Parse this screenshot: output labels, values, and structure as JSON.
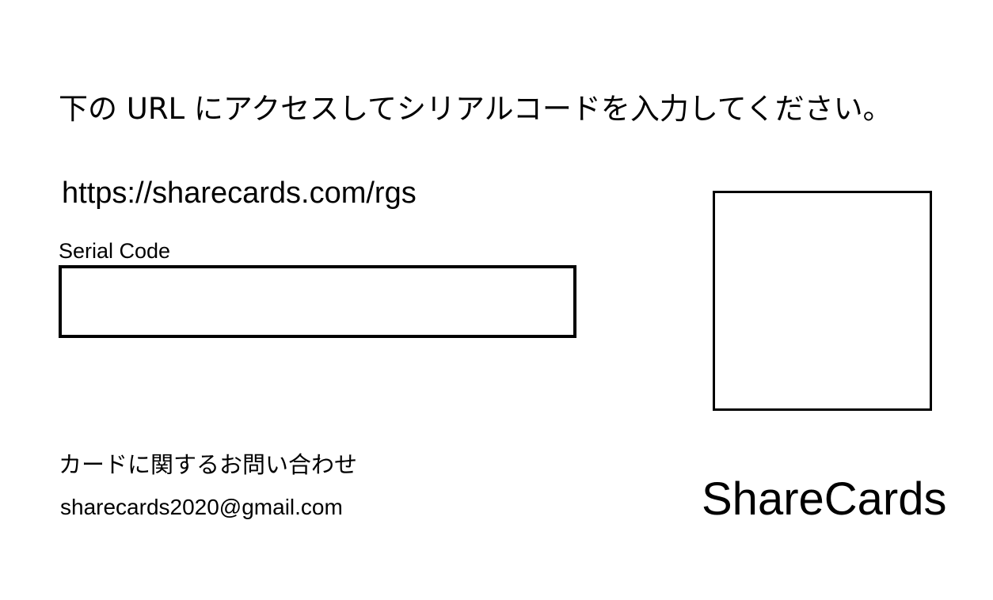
{
  "card": {
    "instruction": "下の URL にアクセスしてシリアルコードを入力してください。",
    "url": "https://sharecards.com/rgs",
    "serial_label": "Serial Code",
    "serial_value": "",
    "contact_label": "カードに関するお問い合わせ",
    "contact_email": "sharecards2020@gmail.com",
    "brand": "ShareCards"
  }
}
